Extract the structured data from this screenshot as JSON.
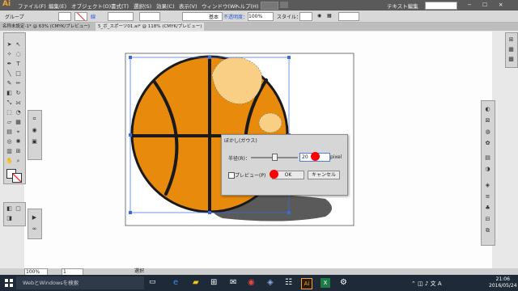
{
  "app": {
    "logo": "Ai",
    "workspace": "テキスト編集"
  },
  "menubar": {
    "items": [
      "ファイル(F)",
      "編集(E)",
      "オブジェクト(O)",
      "書式(T)",
      "選択(S)",
      "効果(C)",
      "表示(V)",
      "ウィンドウ(W)",
      "ヘルプ(H)"
    ]
  },
  "control": {
    "selection_label": "グループ",
    "stroke_label": "線",
    "stroke_style": "基本",
    "opacity_label": "不透明度：",
    "opacity_value": "100%",
    "style_label": "スタイル："
  },
  "tabs": {
    "tab1": "名称未設定-1* @ 63% (CMYK/プレビュー)",
    "tab2": "5_ボ_スポーツ01.ai* @ 118% (CMYK/プレビュー)"
  },
  "dialog": {
    "title": "ぼかし(ガウス)",
    "radius_label": "半径(R)：",
    "radius_value": "20",
    "unit": "pixel",
    "preview_label": "プレビュー(P)",
    "ok_label": "OK",
    "cancel_label": "キャンセル"
  },
  "statusbar": {
    "zoom": "100%",
    "page": "1",
    "mode": "選択"
  },
  "taskbar": {
    "search_placeholder": "WebとWindowsを検索",
    "time": "21:06",
    "date": "2016/05/24"
  },
  "colors": {
    "ball": "#e88a0b",
    "seam": "#1a1a1a",
    "highlight": "#f9cf86",
    "shadow": "#555555",
    "accent": "#ff0000"
  }
}
